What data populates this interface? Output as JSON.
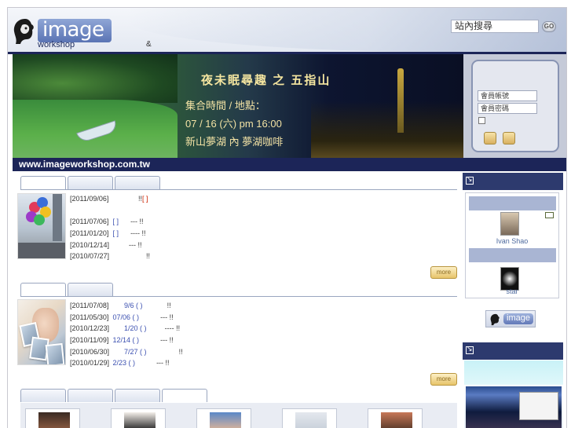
{
  "header": {
    "logo_text": "image",
    "logo_sub": "workshop",
    "ampersand": "&",
    "search_placeholder": "站內搜尋",
    "search_go": "GO"
  },
  "banner": {
    "title": "夜未眠尋趣 之 五指山",
    "lines": [
      "集合時間 / 地點：",
      "07 / 16 (六) pm 16:00",
      "新山夢湖 內 夢湖咖啡"
    ]
  },
  "login": {
    "account_placeholder": "會員帳號",
    "password_placeholder": "會員密碼"
  },
  "url": "www.imageworkshop.com.tw",
  "news1": {
    "rows": [
      {
        "date": "[2011/09/06]",
        "link": "",
        "text": "!!",
        "extra": "[  ]"
      },
      {
        "date": "[2011/07/06]",
        "link": "[  ]",
        "text": "---  !!",
        "extra": ""
      },
      {
        "date": "[2011/01/20]",
        "link": "[  ]",
        "text": "----  !!",
        "extra": ""
      },
      {
        "date": "[2010/12/14]",
        "link": "",
        "text": "---  !!",
        "extra": ""
      },
      {
        "date": "[2010/07/27]",
        "link": "",
        "text": "!!",
        "extra": ""
      }
    ],
    "more": "more"
  },
  "news2": {
    "rows": [
      {
        "date": "[2011/07/08]",
        "link": "9/6 ( )",
        "text": "!!"
      },
      {
        "date": "[2011/05/30]",
        "link": "07/06 ( )",
        "text": "---  !!"
      },
      {
        "date": "[2010/12/23]",
        "link": "1/20 ( )",
        "text": "----  !!"
      },
      {
        "date": "[2010/11/09]",
        "link": "12/14 ( )",
        "text": "---  !!"
      },
      {
        "date": "[2010/06/30]",
        "link": "7/27 ( )",
        "text": "!!"
      },
      {
        "date": "[2010/01/29]",
        "link": "2/23 ( )",
        "text": "---  !!"
      }
    ],
    "more": "more"
  },
  "sidebar": {
    "members": [
      {
        "name": "Ivan Shao"
      },
      {
        "name": "star"
      }
    ],
    "logo_text": "image"
  },
  "colors": {
    "navy": "#1c2558",
    "sidebar_head": "#2d3a6e",
    "link": "#3a4fb0",
    "member_name": "#4e6a9e"
  }
}
